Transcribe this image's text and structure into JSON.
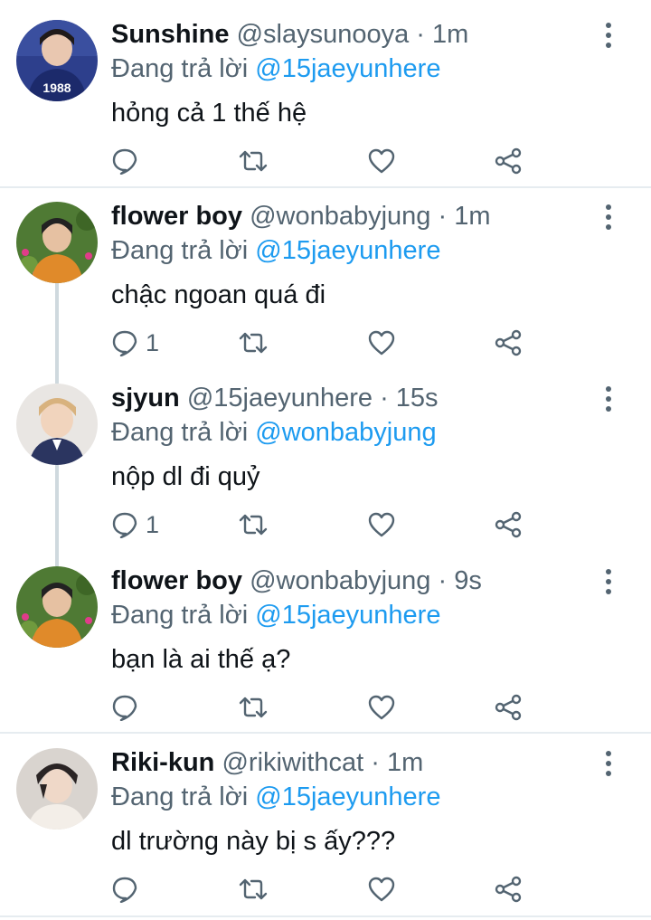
{
  "reply_prefix": "Đang trả lời",
  "colors": {
    "link": "#1d9bf0",
    "secondary": "#536471",
    "primary_text": "#0f1419",
    "divider": "#e6ecf0"
  },
  "icons": {
    "reply": "comment-bubble-icon",
    "retweet": "retweet-icon",
    "like": "heart-icon",
    "share": "share-icon",
    "more": "vertical-ellipsis-icon"
  },
  "tweets": [
    {
      "name": "Sunshine",
      "handle": "@slaysunooya · 1m",
      "reply_to": "@15jaeyunhere",
      "text": "hỏng cả 1 thế hệ",
      "reply_count": "",
      "avatar_text": "1988"
    },
    {
      "name": "flower boy",
      "handle": "@wonbabyjung · 1m",
      "reply_to": "@15jaeyunhere",
      "text": "chậc ngoan quá đi",
      "reply_count": "1"
    },
    {
      "name": "sjyun",
      "handle": "@15jaeyunhere · 15s",
      "reply_to": "@wonbabyjung",
      "text": "nộp dl đi quỷ",
      "reply_count": "1"
    },
    {
      "name": "flower boy",
      "handle": "@wonbabyjung · 9s",
      "reply_to": "@15jaeyunhere",
      "text": "bạn là ai thế ạ?",
      "reply_count": ""
    },
    {
      "name": "Riki-kun",
      "handle": "@rikiwithcat · 1m",
      "reply_to": "@15jaeyunhere",
      "text": "dl trường này bị s ấy???",
      "reply_count": ""
    }
  ]
}
